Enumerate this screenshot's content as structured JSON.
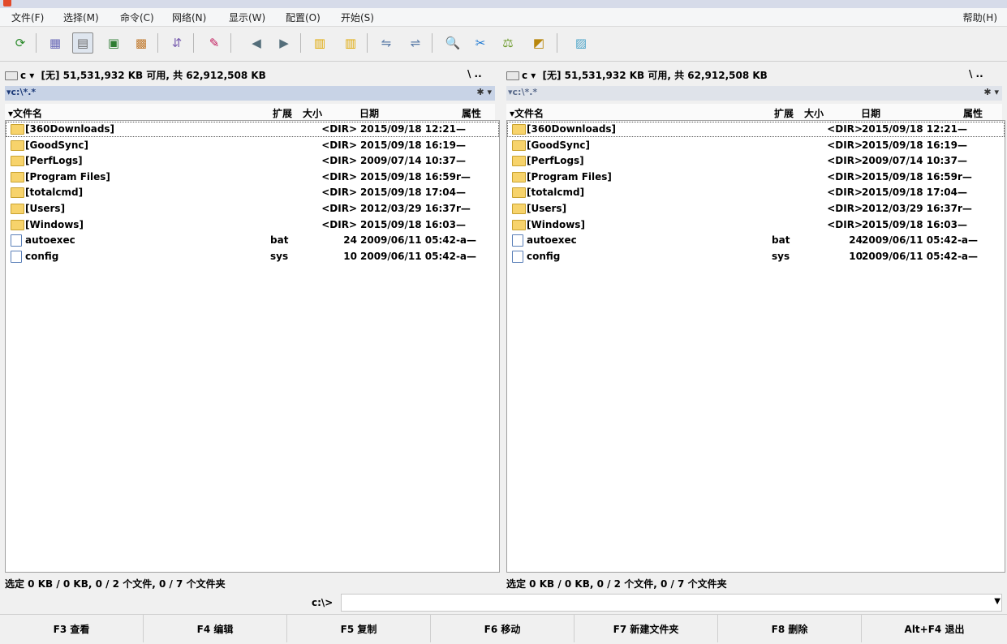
{
  "menu": [
    "文件(F)",
    "选择(M)",
    "命令(C)",
    "网络(N)",
    "显示(W)",
    "配置(O)",
    "开始(S)"
  ],
  "help": "帮助(H)",
  "toolbar": [
    {
      "name": "refresh-icon",
      "glyph": "⟳",
      "color": "#2b8a2b"
    },
    {
      "name": "brief-view-icon",
      "glyph": "▦",
      "color": "#6b6bb8"
    },
    {
      "name": "detail-view-icon",
      "glyph": "▤",
      "color": "#6b6b6b"
    },
    {
      "name": "thumbnail-view-icon",
      "glyph": "▣",
      "color": "#2e7d32"
    },
    {
      "name": "tree-view-icon",
      "glyph": "▩",
      "color": "#c0782b"
    },
    {
      "name": "invert-selection-icon",
      "glyph": "⇵",
      "color": "#7a5fb0"
    },
    {
      "name": "pack-icon",
      "glyph": "✎",
      "color": "#c2185b"
    },
    {
      "name": "back-icon",
      "glyph": "◀",
      "color": "#546e7a"
    },
    {
      "name": "forward-icon",
      "glyph": "▶",
      "color": "#546e7a"
    },
    {
      "name": "zip-pack-icon",
      "glyph": "▥",
      "color": "#e0a800"
    },
    {
      "name": "zip-unpack-icon",
      "glyph": "▥",
      "color": "#e0a800"
    },
    {
      "name": "ftp-connect-icon",
      "glyph": "⇋",
      "color": "#5b7ca8"
    },
    {
      "name": "ftp-disconnect-icon",
      "glyph": "⇌",
      "color": "#5b7ca8"
    },
    {
      "name": "find-icon",
      "glyph": "🔍",
      "color": "#333333"
    },
    {
      "name": "rename-icon",
      "glyph": "✂",
      "color": "#1976d2"
    },
    {
      "name": "sync-dirs-icon",
      "glyph": "⚖",
      "color": "#6c9a2a"
    },
    {
      "name": "compare-icon",
      "glyph": "◩",
      "color": "#b8860b"
    },
    {
      "name": "notepad-icon",
      "glyph": "▨",
      "color": "#4aa3c8"
    }
  ],
  "left": {
    "drive_letter": "c",
    "drive_info": "[无] 51,531,932 KB 可用, 共 62,912,508 KB",
    "drive_buttons": "\\  ..",
    "path": "▾c:\\*.*",
    "path_buttons": "✱ ▾",
    "headers": {
      "name": "▾文件名",
      "ext": "扩展",
      "size": "大小",
      "date": "日期",
      "attr": "属性"
    },
    "files": [
      {
        "name": "[360Downloads]",
        "ext": "",
        "size": "<DIR>",
        "date": "2015/09/18 12:21—",
        "dir": true
      },
      {
        "name": "[GoodSync]",
        "ext": "",
        "size": "<DIR>",
        "date": "2015/09/18 16:19—",
        "dir": true
      },
      {
        "name": "[PerfLogs]",
        "ext": "",
        "size": "<DIR>",
        "date": "2009/07/14 10:37—",
        "dir": true
      },
      {
        "name": "[Program Files]",
        "ext": "",
        "size": "<DIR>",
        "date": "2015/09/18 16:59r—",
        "dir": true
      },
      {
        "name": "[totalcmd]",
        "ext": "",
        "size": "<DIR>",
        "date": "2015/09/18 17:04—",
        "dir": true
      },
      {
        "name": "[Users]",
        "ext": "",
        "size": "<DIR>",
        "date": "2012/03/29 16:37r—",
        "dir": true
      },
      {
        "name": "[Windows]",
        "ext": "",
        "size": "<DIR>",
        "date": "2015/09/18 16:03—",
        "dir": true
      },
      {
        "name": "autoexec",
        "ext": "bat",
        "size": "24",
        "date": "2009/06/11 05:42-a—",
        "dir": false
      },
      {
        "name": "config",
        "ext": "sys",
        "size": "10",
        "date": "2009/06/11 05:42-a—",
        "dir": false
      }
    ],
    "status": "选定 0 KB / 0 KB, 0 / 2 个文件, 0 / 7 个文件夹"
  },
  "right": {
    "drive_letter": "c",
    "drive_info": "[无] 51,531,932 KB 可用, 共 62,912,508 KB",
    "drive_buttons": "\\  ..",
    "path": "▾c:\\*.*",
    "path_buttons": "✱ ▾",
    "headers": {
      "name": "▾文件名",
      "ext": "扩展",
      "size": "大小",
      "date": "日期",
      "attr": "属性"
    },
    "files": [
      {
        "name": "[360Downloads]",
        "ext": "",
        "size": "<DIR>",
        "date": "2015/09/18 12:21—",
        "dir": true
      },
      {
        "name": "[GoodSync]",
        "ext": "",
        "size": "<DIR>",
        "date": "2015/09/18 16:19—",
        "dir": true
      },
      {
        "name": "[PerfLogs]",
        "ext": "",
        "size": "<DIR>",
        "date": "2009/07/14 10:37—",
        "dir": true
      },
      {
        "name": "[Program Files]",
        "ext": "",
        "size": "<DIR>",
        "date": "2015/09/18 16:59r—",
        "dir": true
      },
      {
        "name": "[totalcmd]",
        "ext": "",
        "size": "<DIR>",
        "date": "2015/09/18 17:04—",
        "dir": true
      },
      {
        "name": "[Users]",
        "ext": "",
        "size": "<DIR>",
        "date": "2012/03/29 16:37r—",
        "dir": true
      },
      {
        "name": "[Windows]",
        "ext": "",
        "size": "<DIR>",
        "date": "2015/09/18 16:03—",
        "dir": true
      },
      {
        "name": "autoexec",
        "ext": "bat",
        "size": "24",
        "date": "2009/06/11 05:42-a—",
        "dir": false
      },
      {
        "name": "config",
        "ext": "sys",
        "size": "10",
        "date": "2009/06/11 05:42-a—",
        "dir": false
      }
    ],
    "status": "选定 0 KB / 0 KB, 0 / 2 个文件, 0 / 7 个文件夹"
  },
  "command": {
    "prompt": "c:\\>",
    "value": ""
  },
  "fkeys": [
    "F3 查看",
    "F4 编辑",
    "F5 复制",
    "F6 移动",
    "F7 新建文件夹",
    "F8 删除",
    "Alt+F4 退出"
  ]
}
